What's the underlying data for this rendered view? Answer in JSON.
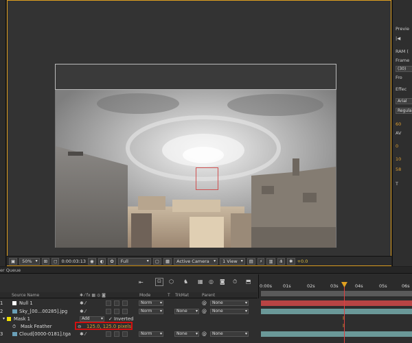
{
  "colors": {
    "accent": "#e0a020",
    "null_swatch": "#ffffff",
    "sky_swatch": "#6aa0b8",
    "mask_swatch": "#f0e000",
    "null_bar": "#b84444",
    "sky_bar": "#6a9898",
    "cloud_bar": "#6a9898",
    "highlight": "#d01010"
  },
  "viewer": {
    "zoom": "50%",
    "timecode": "0:00:03:13",
    "resolution": "Full",
    "camera": "Active Camera",
    "views": "1 View",
    "exposure": "+0.0",
    "icons": [
      "region-icon",
      "transparency-grid-icon",
      "snapshot-icon",
      "color-channels-icon",
      "fast-preview-icon",
      "timeline-icon",
      "flowchart-icon",
      "exposure-reset-icon"
    ]
  },
  "right_panel": {
    "preview_title": "Previe",
    "ram": "RAM (",
    "frame_label": "Frame",
    "frame_value": "(30)",
    "from_label": "Fro",
    "effects_title": "Effec",
    "font": "Arial",
    "font_style": "Regula",
    "size_value": "60",
    "tracking": "AV",
    "leading": "0",
    "scale_value": "10",
    "baseline_value": "58",
    "tsume": "T"
  },
  "queue_tab": "er Queue",
  "timeline": {
    "headers": {
      "source_name": "Source Name",
      "mode": "Mode",
      "t": "T",
      "trkmat": "TrkMat",
      "parent": "Parent"
    },
    "ruler_labels": [
      "0:00s",
      "01s",
      "02s",
      "03s",
      "04s",
      "05s",
      "06s"
    ],
    "layers": [
      {
        "num": "1",
        "name": "Null 1",
        "mode": "Norm",
        "trkmat": "",
        "parent": "None"
      },
      {
        "num": "2",
        "name": "Sky_[00...00285].jpg",
        "mode": "Norm",
        "trkmat": "None",
        "parent": "None"
      },
      {
        "num": "3",
        "name": "Cloud[0000-0181].tga",
        "mode": "Norm",
        "trkmat": "None",
        "parent": "None"
      }
    ],
    "mask": {
      "name": "Mask 1",
      "mode": "Add",
      "inverted_label": "Inverted",
      "feather_label": "Mask Feather",
      "feather_value": "125.0, 125.0 pixels"
    }
  }
}
